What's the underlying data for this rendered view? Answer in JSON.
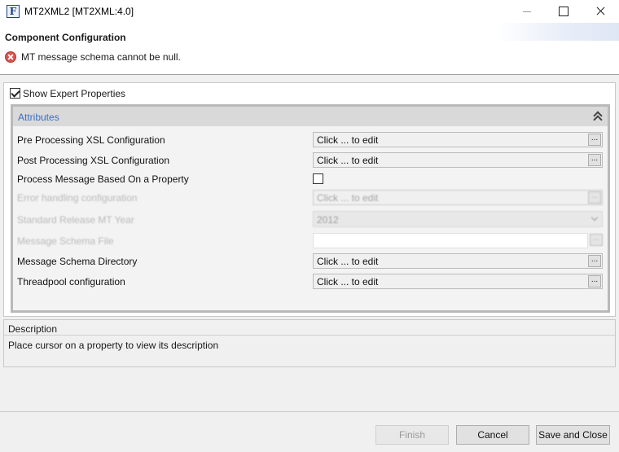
{
  "window": {
    "app_icon_letter": "F",
    "title": "MT2XML2 [MT2XML:4.0]"
  },
  "header": {
    "title": "Component Configuration",
    "error_message": "MT message schema cannot be null."
  },
  "expert": {
    "label": "Show Expert Properties",
    "checked": true
  },
  "section": {
    "title": "Attributes"
  },
  "properties": [
    {
      "label": "Pre Processing XSL Configuration",
      "value": "Click ... to edit",
      "button": "..."
    },
    {
      "label": "Post Processing XSL Configuration",
      "value": "Click ... to edit",
      "button": "..."
    },
    {
      "label": "Process Message Based On a Property",
      "checked": false
    },
    {
      "label": "Error handling configuration",
      "value": "Click ... to edit",
      "button": "..."
    },
    {
      "label": "Standard Release MT Year",
      "value": "2012"
    },
    {
      "label": "Message Schema File",
      "value": "",
      "button": "..."
    },
    {
      "label": "Message Schema Directory",
      "value": "Click ... to edit",
      "button": "..."
    },
    {
      "label": "Threadpool configuration",
      "value": "Click ... to edit",
      "button": "..."
    }
  ],
  "description": {
    "title": "Description",
    "text": "Place cursor on a property to view its description"
  },
  "buttons": {
    "finish": "Finish",
    "cancel": "Cancel",
    "save_close": "Save and Close"
  }
}
